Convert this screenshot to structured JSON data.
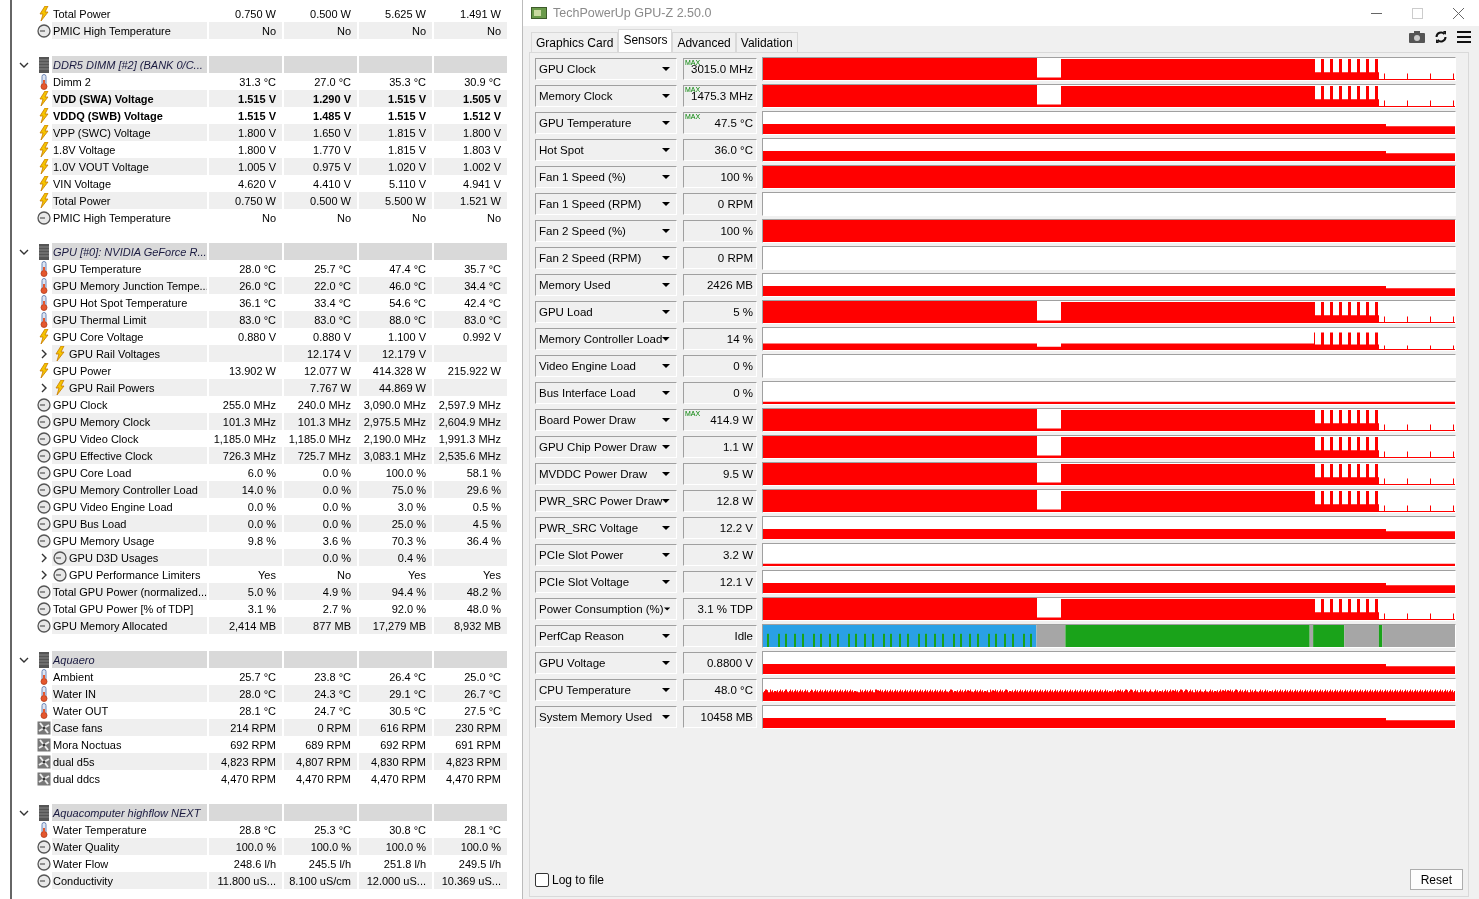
{
  "sensor_list": {
    "groups": [
      {
        "children": [
          {
            "kind": "bolt",
            "label": "Total Power",
            "bold": false,
            "column_2": "0.750 W",
            "column_3": "0.500 W",
            "column_4": "5.625 W",
            "column_5": "1.491 W"
          },
          {
            "kind": "clock",
            "label": "PMIC High Temperature",
            "bold": false,
            "column_2": "No",
            "column_3": "No",
            "column_4": "No",
            "column_5": "No"
          }
        ]
      },
      {
        "label": "DDR5 DIMM [#2] (BANK 0/C...",
        "expanded": true,
        "children": [
          {
            "kind": "thermo",
            "label": "Dimm 2",
            "bold": false,
            "column_2": "31.3 °C",
            "column_3": "27.0 °C",
            "column_4": "35.3 °C",
            "column_5": "30.9 °C"
          },
          {
            "kind": "bolt",
            "label": "VDD (SWA) Voltage",
            "bold": true,
            "column_2": "1.515 V",
            "column_3": "1.290 V",
            "column_4": "1.515 V",
            "column_5": "1.505 V"
          },
          {
            "kind": "bolt",
            "label": "VDDQ (SWB) Voltage",
            "bold": true,
            "column_2": "1.515 V",
            "column_3": "1.485 V",
            "column_4": "1.515 V",
            "column_5": "1.512 V"
          },
          {
            "kind": "bolt",
            "label": "VPP (SWC) Voltage",
            "bold": false,
            "column_2": "1.800 V",
            "column_3": "1.650 V",
            "column_4": "1.815 V",
            "column_5": "1.800 V"
          },
          {
            "kind": "bolt",
            "label": "1.8V Voltage",
            "bold": false,
            "column_2": "1.800 V",
            "column_3": "1.770 V",
            "column_4": "1.815 V",
            "column_5": "1.803 V"
          },
          {
            "kind": "bolt",
            "label": "1.0V VOUT Voltage",
            "bold": false,
            "column_2": "1.005 V",
            "column_3": "0.975 V",
            "column_4": "1.020 V",
            "column_5": "1.002 V"
          },
          {
            "kind": "bolt",
            "label": "VIN Voltage",
            "bold": false,
            "column_2": "4.620 V",
            "column_3": "4.410 V",
            "column_4": "5.110 V",
            "column_5": "4.941 V"
          },
          {
            "kind": "bolt",
            "label": "Total Power",
            "bold": false,
            "column_2": "0.750 W",
            "column_3": "0.500 W",
            "column_4": "5.500 W",
            "column_5": "1.521 W"
          },
          {
            "kind": "clock",
            "label": "PMIC High Temperature",
            "bold": false,
            "column_2": "No",
            "column_3": "No",
            "column_4": "No",
            "column_5": "No"
          }
        ]
      },
      {
        "label": "GPU [#0]: NVIDIA GeForce R...",
        "expanded": true,
        "children": [
          {
            "kind": "thermo",
            "label": "GPU Temperature",
            "bold": false,
            "column_2": "28.0 °C",
            "column_3": "25.7 °C",
            "column_4": "47.4 °C",
            "column_5": "35.7 °C"
          },
          {
            "kind": "thermo",
            "label": "GPU Memory Junction Tempe...",
            "bold": false,
            "column_2": "26.0 °C",
            "column_3": "22.0 °C",
            "column_4": "46.0 °C",
            "column_5": "34.4 °C"
          },
          {
            "kind": "thermo",
            "label": "GPU Hot Spot Temperature",
            "bold": false,
            "column_2": "36.1 °C",
            "column_3": "33.4 °C",
            "column_4": "54.6 °C",
            "column_5": "42.4 °C"
          },
          {
            "kind": "thermo",
            "label": "GPU Thermal Limit",
            "bold": false,
            "column_2": "83.0 °C",
            "column_3": "83.0 °C",
            "column_4": "88.0 °C",
            "column_5": "83.0 °C"
          },
          {
            "kind": "bolt",
            "label": "GPU Core Voltage",
            "bold": false,
            "column_2": "0.880 V",
            "column_3": "0.880 V",
            "column_4": "1.100 V",
            "column_5": "0.992 V"
          },
          {
            "kind": "bolt",
            "label": "GPU Rail Voltages",
            "bold": false,
            "expanded": false,
            "column_3": "12.174 V",
            "column_4": "12.179 V"
          },
          {
            "kind": "bolt",
            "label": "GPU Power",
            "bold": false,
            "column_2": "13.902 W",
            "column_3": "12.077 W",
            "column_4": "414.328 W",
            "column_5": "215.922 W"
          },
          {
            "kind": "bolt",
            "label": "GPU Rail Powers",
            "bold": false,
            "expanded": false,
            "column_3": "7.767 W",
            "column_4": "44.869 W"
          },
          {
            "kind": "clock",
            "label": "GPU Clock",
            "bold": false,
            "column_2": "255.0 MHz",
            "column_3": "240.0 MHz",
            "column_4": "3,090.0 MHz",
            "column_5": "2,597.9 MHz"
          },
          {
            "kind": "clock",
            "label": "GPU Memory Clock",
            "bold": false,
            "column_2": "101.3 MHz",
            "column_3": "101.3 MHz",
            "column_4": "2,975.5 MHz",
            "column_5": "2,604.9 MHz"
          },
          {
            "kind": "clock",
            "label": "GPU Video Clock",
            "bold": false,
            "column_2": "1,185.0 MHz",
            "column_3": "1,185.0 MHz",
            "column_4": "2,190.0 MHz",
            "column_5": "1,991.3 MHz"
          },
          {
            "kind": "clock",
            "label": "GPU Effective Clock",
            "bold": false,
            "column_2": "726.3 MHz",
            "column_3": "725.7 MHz",
            "column_4": "3,083.1 MHz",
            "column_5": "2,535.6 MHz"
          },
          {
            "kind": "clock",
            "label": "GPU Core Load",
            "bold": false,
            "column_2": "6.0 %",
            "column_3": "0.0 %",
            "column_4": "100.0 %",
            "column_5": "58.1 %"
          },
          {
            "kind": "clock",
            "label": "GPU Memory Controller Load",
            "bold": false,
            "column_2": "14.0 %",
            "column_3": "0.0 %",
            "column_4": "75.0 %",
            "column_5": "29.6 %"
          },
          {
            "kind": "clock",
            "label": "GPU Video Engine Load",
            "bold": false,
            "column_2": "0.0 %",
            "column_3": "0.0 %",
            "column_4": "3.0 %",
            "column_5": "0.5 %"
          },
          {
            "kind": "clock",
            "label": "GPU Bus Load",
            "bold": false,
            "column_2": "0.0 %",
            "column_3": "0.0 %",
            "column_4": "25.0 %",
            "column_5": "4.5 %"
          },
          {
            "kind": "clock",
            "label": "GPU Memory Usage",
            "bold": false,
            "column_2": "9.8 %",
            "column_3": "3.6 %",
            "column_4": "70.3 %",
            "column_5": "36.4 %"
          },
          {
            "kind": "clock",
            "label": "GPU D3D Usages",
            "bold": false,
            "expanded": false,
            "column_3": "0.0 %",
            "column_4": "0.4 %"
          },
          {
            "kind": "clock",
            "label": "GPU Performance Limiters",
            "bold": false,
            "expanded": false,
            "column_2": "Yes",
            "column_3": "No",
            "column_4": "Yes",
            "column_5": "Yes"
          },
          {
            "kind": "clock",
            "label": "Total GPU Power (normalized...",
            "bold": false,
            "column_2": "5.0 %",
            "column_3": "4.9 %",
            "column_4": "94.4 %",
            "column_5": "48.2 %"
          },
          {
            "kind": "clock",
            "label": "Total GPU Power [% of TDP]",
            "bold": false,
            "column_2": "3.1 %",
            "column_3": "2.7 %",
            "column_4": "92.0 %",
            "column_5": "48.0 %"
          },
          {
            "kind": "clock",
            "label": "GPU Memory Allocated",
            "bold": false,
            "column_2": "2,414 MB",
            "column_3": "877 MB",
            "column_4": "17,279 MB",
            "column_5": "8,932 MB"
          }
        ]
      },
      {
        "label": "Aquaero",
        "expanded": true,
        "children": [
          {
            "kind": "thermo",
            "label": "Ambient",
            "bold": false,
            "column_2": "25.7 °C",
            "column_3": "23.8 °C",
            "column_4": "26.4 °C",
            "column_5": "25.0 °C"
          },
          {
            "kind": "thermo",
            "label": "Water IN",
            "bold": false,
            "column_2": "28.0 °C",
            "column_3": "24.3 °C",
            "column_4": "29.1 °C",
            "column_5": "26.7 °C"
          },
          {
            "kind": "thermo",
            "label": "Water OUT",
            "bold": false,
            "column_2": "28.1 °C",
            "column_3": "24.7 °C",
            "column_4": "30.5 °C",
            "column_5": "27.5 °C"
          },
          {
            "kind": "fan",
            "label": "Case fans",
            "bold": false,
            "column_2": "214 RPM",
            "column_3": "0 RPM",
            "column_4": "616 RPM",
            "column_5": "230 RPM"
          },
          {
            "kind": "fan",
            "label": "Mora Noctuas",
            "bold": false,
            "column_2": "692 RPM",
            "column_3": "689 RPM",
            "column_4": "692 RPM",
            "column_5": "691 RPM"
          },
          {
            "kind": "fan",
            "label": "dual d5s",
            "bold": false,
            "column_2": "4,823 RPM",
            "column_3": "4,807 RPM",
            "column_4": "4,830 RPM",
            "column_5": "4,823 RPM"
          },
          {
            "kind": "fan",
            "label": "dual ddcs",
            "bold": false,
            "column_2": "4,470 RPM",
            "column_3": "4,470 RPM",
            "column_4": "4,470 RPM",
            "column_5": "4,470 RPM"
          }
        ]
      },
      {
        "label": "Aquacomputer highflow NEXT",
        "expanded": true,
        "children": [
          {
            "kind": "thermo",
            "label": "Water Temperature",
            "bold": false,
            "column_2": "28.8 °C",
            "column_3": "25.3 °C",
            "column_4": "30.8 °C",
            "column_5": "28.1 °C"
          },
          {
            "kind": "clock",
            "label": "Water Quality",
            "bold": false,
            "column_2": "100.0 %",
            "column_3": "100.0 %",
            "column_4": "100.0 %",
            "column_5": "100.0 %"
          },
          {
            "kind": "clock",
            "label": "Water Flow",
            "bold": false,
            "column_2": "248.6 l/h",
            "column_3": "245.5 l/h",
            "column_4": "251.8 l/h",
            "column_5": "249.5 l/h"
          },
          {
            "kind": "clock",
            "label": "Conductivity",
            "bold": false,
            "column_2": "11.800 uS...",
            "column_3": "8.100 uS/cm",
            "column_4": "12.000 uS...",
            "column_5": "10.369 uS..."
          }
        ]
      }
    ]
  },
  "gpuz": {
    "title": "TechPowerUp GPU-Z 2.50.0",
    "tabs": [
      {
        "label": "Graphics Card",
        "selected": false
      },
      {
        "label": "Sensors",
        "selected": true
      },
      {
        "label": "Advanced",
        "selected": false
      },
      {
        "label": "Validation",
        "selected": false
      }
    ],
    "sensors": [
      {
        "name": "GPU Clock",
        "reading": "3015.0 MHz",
        "flag": "MAX",
        "kind": "busy"
      },
      {
        "name": "Memory Clock",
        "reading": "1475.3 MHz",
        "flag": "MAX",
        "kind": "busy"
      },
      {
        "name": "GPU Temperature",
        "reading": "47.5 °C",
        "flag": "MAX",
        "kind": "band"
      },
      {
        "name": "Hot Spot",
        "reading": "36.0 °C",
        "kind": "band"
      },
      {
        "name": "Fan 1 Speed (%)",
        "reading": "100 %",
        "kind": "full"
      },
      {
        "name": "Fan 1 Speed (RPM)",
        "reading": "0 RPM",
        "kind": "empty"
      },
      {
        "name": "Fan 2 Speed (%)",
        "reading": "100 %",
        "kind": "full"
      },
      {
        "name": "Fan 2 Speed (RPM)",
        "reading": "0 RPM",
        "kind": "empty"
      },
      {
        "name": "Memory Used",
        "reading": "2426 MB",
        "kind": "band"
      },
      {
        "name": "GPU Load",
        "reading": "5 %",
        "kind": "busy"
      },
      {
        "name": "Memory Controller Load",
        "reading": "14 %",
        "kind": "lowbusy"
      },
      {
        "name": "Video Engine Load",
        "reading": "0 %",
        "kind": "empty"
      },
      {
        "name": "Bus Interface Load",
        "reading": "0 %",
        "kind": "line"
      },
      {
        "name": "Board Power Draw",
        "reading": "414.9 W",
        "flag": "MAX",
        "kind": "busy"
      },
      {
        "name": "GPU Chip Power Draw",
        "reading": "1.1 W",
        "kind": "busy"
      },
      {
        "name": "MVDDC Power Draw",
        "reading": "9.5 W",
        "kind": "busy"
      },
      {
        "name": "PWR_SRC Power Draw",
        "reading": "12.8 W",
        "kind": "busy"
      },
      {
        "name": "PWR_SRC Voltage",
        "reading": "12.2 V",
        "kind": "band"
      },
      {
        "name": "PCIe Slot Power",
        "reading": "3.2 W",
        "kind": "line"
      },
      {
        "name": "PCIe Slot Voltage",
        "reading": "12.1 V",
        "kind": "band"
      },
      {
        "name": "Power Consumption (%)",
        "reading": "3.1 % TDP",
        "kind": "busy"
      },
      {
        "name": "PerfCap Reason",
        "reading": "Idle",
        "kind": "perfcap"
      },
      {
        "name": "GPU Voltage",
        "reading": "0.8800 V",
        "kind": "band"
      },
      {
        "name": "CPU Temperature",
        "reading": "48.0 °C",
        "kind": "noisy"
      },
      {
        "name": "System Memory Used",
        "reading": "10458 MB",
        "kind": "band"
      }
    ],
    "log_to_file": {
      "label": "Log to file",
      "checked": false
    },
    "reset_button": "Reset"
  }
}
